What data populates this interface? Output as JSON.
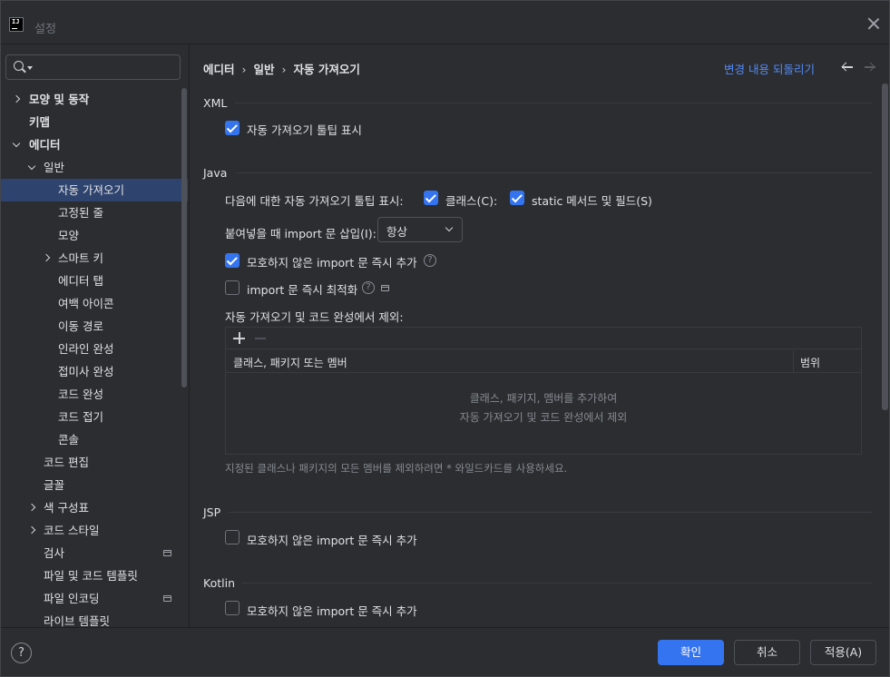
{
  "window": {
    "title": "설정"
  },
  "sidebar": {
    "search": {
      "value": "",
      "placeholder": ""
    },
    "items": [
      {
        "label": "모양 및 동작",
        "indent": 0,
        "chevron": "right",
        "bold": true
      },
      {
        "label": "키맵",
        "indent": 0,
        "chevron": "none",
        "bold": true
      },
      {
        "label": "에디터",
        "indent": 0,
        "chevron": "down",
        "bold": true
      },
      {
        "label": "일반",
        "indent": 1,
        "chevron": "down"
      },
      {
        "label": "자동 가져오기",
        "indent": 2,
        "chevron": "none",
        "selected": true
      },
      {
        "label": "고정된 줄",
        "indent": 2,
        "chevron": "none"
      },
      {
        "label": "모양",
        "indent": 2,
        "chevron": "none"
      },
      {
        "label": "스마트 키",
        "indent": 2,
        "chevron": "right"
      },
      {
        "label": "에디터 탭",
        "indent": 2,
        "chevron": "none"
      },
      {
        "label": "여백 아이콘",
        "indent": 2,
        "chevron": "none"
      },
      {
        "label": "이동 경로",
        "indent": 2,
        "chevron": "none"
      },
      {
        "label": "인라인 완성",
        "indent": 2,
        "chevron": "none"
      },
      {
        "label": "접미사 완성",
        "indent": 2,
        "chevron": "none"
      },
      {
        "label": "코드 완성",
        "indent": 2,
        "chevron": "none"
      },
      {
        "label": "코드 접기",
        "indent": 2,
        "chevron": "none"
      },
      {
        "label": "콘솔",
        "indent": 2,
        "chevron": "none"
      },
      {
        "label": "코드 편집",
        "indent": 1,
        "chevron": "none"
      },
      {
        "label": "글꼴",
        "indent": 1,
        "chevron": "none"
      },
      {
        "label": "색 구성표",
        "indent": 1,
        "chevron": "right"
      },
      {
        "label": "코드 스타일",
        "indent": 1,
        "chevron": "right"
      },
      {
        "label": "검사",
        "indent": 1,
        "chevron": "none",
        "project_icon": true
      },
      {
        "label": "파일 및 코드 템플릿",
        "indent": 1,
        "chevron": "none"
      },
      {
        "label": "파일 인코딩",
        "indent": 1,
        "chevron": "none",
        "project_icon": true
      },
      {
        "label": "라이브 템플릿",
        "indent": 1,
        "chevron": "none"
      }
    ]
  },
  "header": {
    "breadcrumb": [
      "에디터",
      "일반",
      "자동 가져오기"
    ],
    "breadcrumb_sep": "›",
    "reset_label": "변경 내용 되돌리기"
  },
  "xml": {
    "title": "XML",
    "show_tooltip": {
      "label": "자동 가져오기 툴팁 표시",
      "checked": true
    }
  },
  "java": {
    "title": "Java",
    "tooltip_prefix": "다음에 대한 자동 가져오기 툴팁 표시:",
    "classes": {
      "label": "클래스(C):",
      "checked": true
    },
    "static_members": {
      "label": "static 메서드 및 필드(S)",
      "checked": true
    },
    "insert_import_label": "붙여넣을 때 import 문 삽입(I):",
    "insert_import_value": "항상",
    "add_unambiguous": {
      "label": "모호하지 않은 import 문 즉시 추가",
      "checked": true
    },
    "optimize_imports": {
      "label": "import 문 즉시 최적화",
      "checked": false
    },
    "exclude_title": "자동 가져오기 및 코드 완성에서 제외:",
    "table": {
      "col_name": "클래스, 패키지 또는 멤버",
      "col_scope": "범위",
      "empty_line1": "클래스, 패키지, 멤버를 추가하여",
      "empty_line2": "자동 가져오기 및 코드 완성에서 제외"
    },
    "hint": "지정된 클래스나 패키지의 모든 멤버를 제외하려면 * 와일드카드를 사용하세요."
  },
  "jsp": {
    "title": "JSP",
    "add_unambiguous": {
      "label": "모호하지 않은 import 문 즉시 추가",
      "checked": false
    }
  },
  "kotlin": {
    "title": "Kotlin",
    "add_unambiguous": {
      "label": "모호하지 않은 import 문 즉시 추가",
      "checked": false
    }
  },
  "footer": {
    "ok_label": "확인",
    "cancel_label": "취소",
    "apply_label": "적용(A)",
    "help_glyph": "?"
  },
  "colors": {
    "accent": "#3574f0",
    "link": "#548af7",
    "selection": "#2e436e",
    "background": "#2b2d30"
  }
}
